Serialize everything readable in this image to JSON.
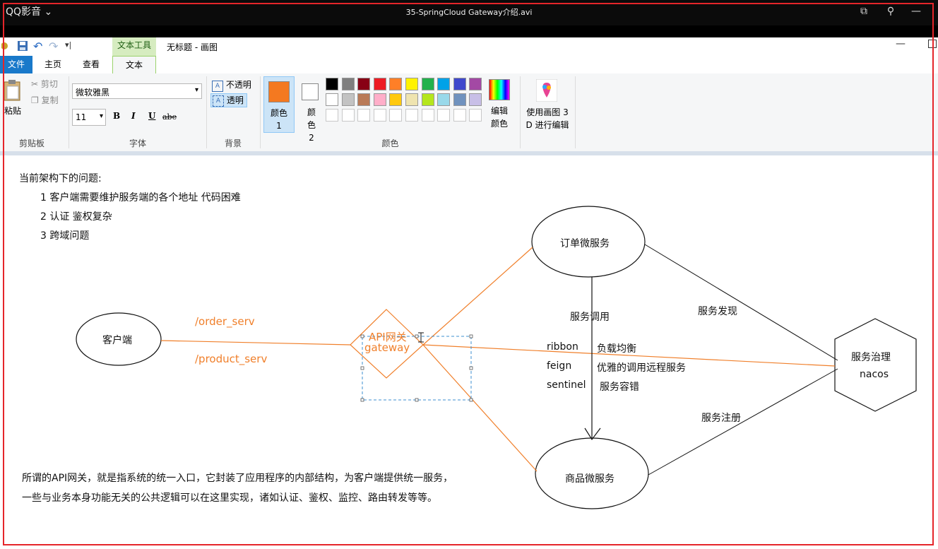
{
  "player": {
    "name": "QQ影音",
    "title": "35-SpringCloud Gateway介绍.avi"
  },
  "paint": {
    "context_tab": "文本工具",
    "doc_title": "无标题 - 画图",
    "tabs": [
      "文件",
      "主页",
      "查看",
      "文本"
    ],
    "clipboard": {
      "paste": "粘贴",
      "cut": "剪切",
      "copy": "复制",
      "label": "剪贴板"
    },
    "font": {
      "family": "微软雅黑",
      "size": "11",
      "bold": "B",
      "italic": "I",
      "underline": "U",
      "strike": "abe",
      "label": "字体"
    },
    "background": {
      "opaque": "不透明",
      "transparent": "透明",
      "label": "背景"
    },
    "colors": {
      "color1_label": "颜色 1",
      "color2_label": "颜色 2",
      "edit_label": "编辑颜色",
      "label": "颜色",
      "color1": "#f47920",
      "color2": "#ffffff",
      "row1": [
        "#000000",
        "#7f7f7f",
        "#880015",
        "#ed1c24",
        "#ff7f27",
        "#fff200",
        "#22b14c",
        "#00a2e8",
        "#3f48cc",
        "#a349a4"
      ],
      "row2": [
        "#ffffff",
        "#c3c3c3",
        "#b97a57",
        "#ffaec9",
        "#ffc90e",
        "#efe4b0",
        "#b5e61d",
        "#99d9ea",
        "#7092be",
        "#c8bfe7"
      ],
      "row3": [
        "#ffffff",
        "#ffffff",
        "#ffffff",
        "#ffffff",
        "#ffffff",
        "#ffffff",
        "#ffffff",
        "#ffffff",
        "#ffffff",
        "#ffffff"
      ]
    },
    "paint3d": "使用画图 3D 进行编辑"
  },
  "canvas": {
    "problems_title": "当前架构下的问题:",
    "problems": [
      "1  客户端需要维护服务端的各个地址  代码困难",
      "2  认证 鉴权复杂",
      "3  跨域问题"
    ],
    "client": "客户端",
    "route1": "/order_serv",
    "route2": "/product_serv",
    "gateway_line1": "API网关",
    "gateway_line2": "gateway",
    "order_service": "订单微服务",
    "product_service": "商品微服务",
    "service_call": "服务调用",
    "ribbon": "ribbon",
    "ribbon_desc": "负载均衡",
    "feign": "feign",
    "feign_desc": "优雅的调用远程服务",
    "sentinel": "sentinel",
    "sentinel_desc": "服务容错",
    "discovery": "服务发现",
    "register": "服务注册",
    "governance": "服务治理",
    "nacos": "nacos",
    "desc_line1": "所谓的API网关，就是指系统的统一入口，它封装了应用程序的内部结构，为客户端提供统一服务，",
    "desc_line2": "一些与业务本身功能无关的公共逻辑可以在这里实现，诸如认证、鉴权、监控、路由转发等等。"
  }
}
